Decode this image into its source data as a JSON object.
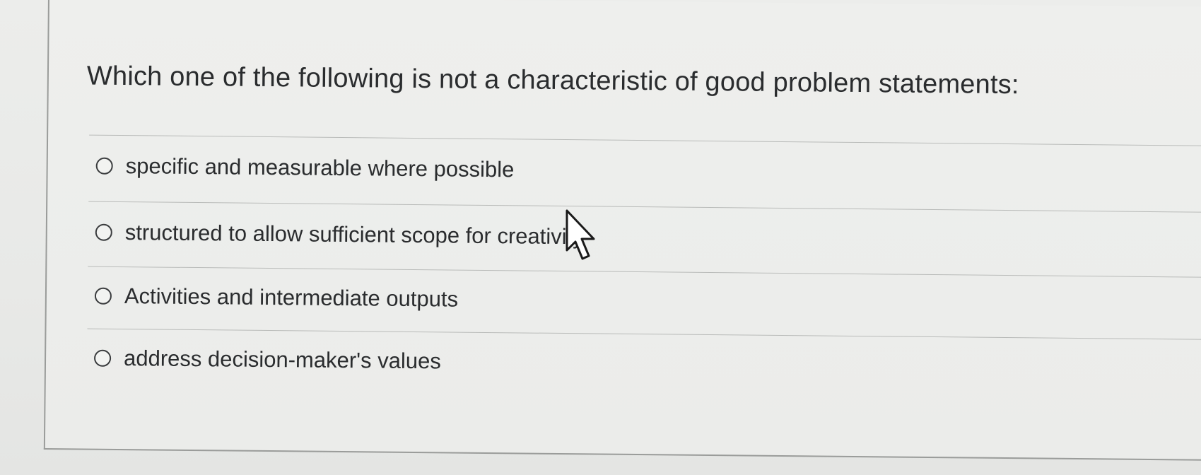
{
  "question": {
    "text": "Which one of the following is not a characteristic of good problem statements:"
  },
  "options": [
    {
      "label": "specific and measurable where possible",
      "selected": false
    },
    {
      "label": "structured to allow sufficient scope for creativity",
      "selected": false
    },
    {
      "label": "Activities and intermediate outputs",
      "selected": false
    },
    {
      "label": "address decision-maker's values",
      "selected": false
    }
  ],
  "cursor": {
    "icon": "arrow-cursor-icon"
  }
}
